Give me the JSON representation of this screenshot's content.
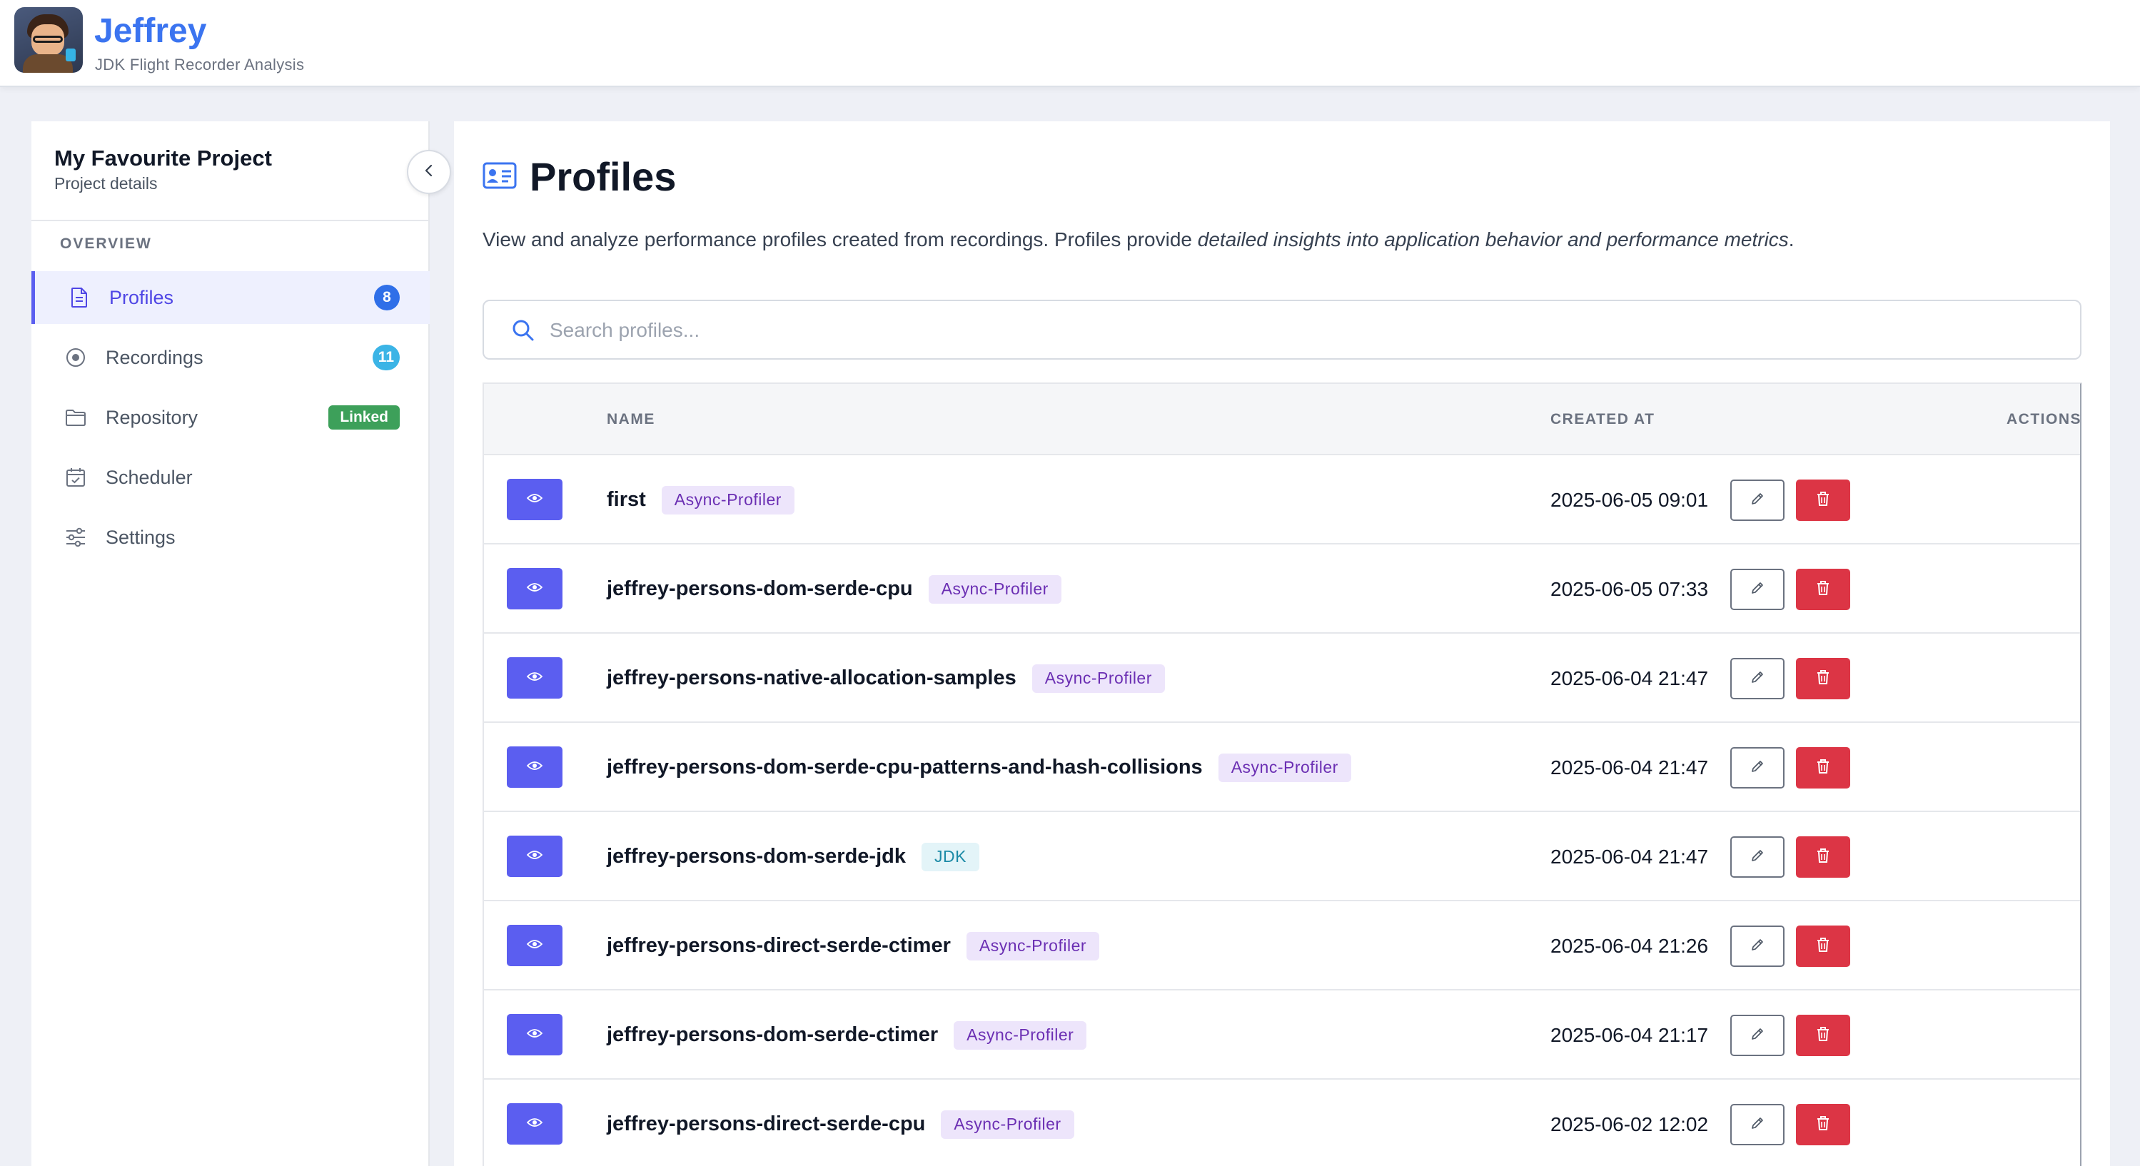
{
  "header": {
    "app_name": "Jeffrey",
    "app_subtitle": "JDK Flight Recorder Analysis"
  },
  "sidebar": {
    "project_name": "My Favourite Project",
    "project_subtitle": "Project details",
    "section_label": "OVERVIEW",
    "items": [
      {
        "label": "Profiles",
        "icon": "file-text-icon",
        "badge": "8",
        "badge_color": "#2f6fe8",
        "active": true
      },
      {
        "label": "Recordings",
        "icon": "record-circle-icon",
        "badge": "11",
        "badge_color": "#3bb4e6",
        "active": false
      },
      {
        "label": "Repository",
        "icon": "folder-icon",
        "badge": "Linked",
        "badge_color": "#3da05a",
        "active": false
      },
      {
        "label": "Scheduler",
        "icon": "calendar-check-icon",
        "active": false
      },
      {
        "label": "Settings",
        "icon": "sliders-icon",
        "active": false
      }
    ]
  },
  "main": {
    "title": "Profiles",
    "title_icon": "profile-card-icon",
    "description_plain": "View and analyze performance profiles created from recordings. Profiles provide ",
    "description_italic": "detailed insights into application behavior and performance metrics",
    "description_end": ".",
    "search_placeholder": "Search profiles...",
    "columns": {
      "name": "NAME",
      "created_at": "CREATED AT",
      "actions": "ACTIONS"
    },
    "rows": [
      {
        "name": "first",
        "source": "Async-Profiler",
        "created_at": "2025-06-05 09:01"
      },
      {
        "name": "jeffrey-persons-dom-serde-cpu",
        "source": "Async-Profiler",
        "created_at": "2025-06-05 07:33"
      },
      {
        "name": "jeffrey-persons-native-allocation-samples",
        "source": "Async-Profiler",
        "created_at": "2025-06-04 21:47"
      },
      {
        "name": "jeffrey-persons-dom-serde-cpu-patterns-and-hash-collisions",
        "source": "Async-Profiler",
        "created_at": "2025-06-04 21:47"
      },
      {
        "name": "jeffrey-persons-dom-serde-jdk",
        "source": "JDK",
        "created_at": "2025-06-04 21:47"
      },
      {
        "name": "jeffrey-persons-direct-serde-ctimer",
        "source": "Async-Profiler",
        "created_at": "2025-06-04 21:26"
      },
      {
        "name": "jeffrey-persons-dom-serde-ctimer",
        "source": "Async-Profiler",
        "created_at": "2025-06-04 21:17"
      },
      {
        "name": "jeffrey-persons-direct-serde-cpu",
        "source": "Async-Profiler",
        "created_at": "2025-06-02 12:02"
      }
    ]
  },
  "colors": {
    "accent": "#5b5ef0",
    "brand": "#3b74f0",
    "danger": "#dc3545",
    "async_tag_bg": "#ede5fb",
    "jdk_tag_bg": "#e3f4f8"
  }
}
